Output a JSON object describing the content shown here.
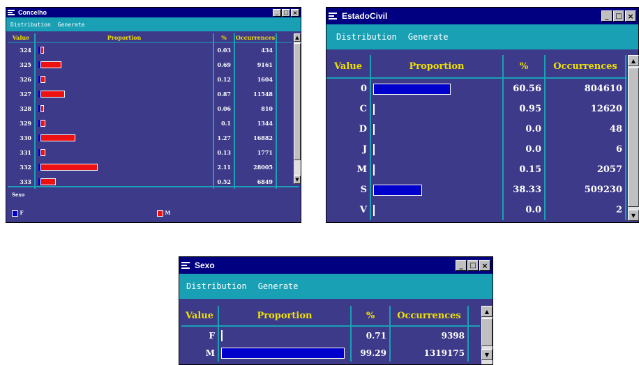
{
  "colors": {
    "female": "#0000cc",
    "male": "#ee1111",
    "bar": "#0000cc",
    "header_text": "#f0e000",
    "grid_bg": "#3d3a8a",
    "menubar": "#1aa0b4"
  },
  "concelho": {
    "title": "Concelho",
    "menu": [
      "Distribution",
      "Generate"
    ],
    "headers": [
      "Value",
      "Proportion",
      "%",
      "Occurrences"
    ],
    "rows": [
      {
        "value": "324",
        "pct": "0.03",
        "occ": "434",
        "f": 0.012,
        "m": 0.02
      },
      {
        "value": "325",
        "pct": "0.69",
        "occ": "9161",
        "f": 0.012,
        "m": 0.12
      },
      {
        "value": "326",
        "pct": "0.12",
        "occ": "1604",
        "f": 0.012,
        "m": 0.03
      },
      {
        "value": "327",
        "pct": "0.87",
        "occ": "11548",
        "f": 0.012,
        "m": 0.14
      },
      {
        "value": "328",
        "pct": "0.06",
        "occ": "810",
        "f": 0.012,
        "m": 0.02
      },
      {
        "value": "329",
        "pct": "0.1",
        "occ": "1344",
        "f": 0.012,
        "m": 0.03
      },
      {
        "value": "330",
        "pct": "1.27",
        "occ": "16882",
        "f": 0.012,
        "m": 0.2
      },
      {
        "value": "331",
        "pct": "0.13",
        "occ": "1771",
        "f": 0.012,
        "m": 0.03
      },
      {
        "value": "332",
        "pct": "2.11",
        "occ": "28005",
        "f": 0.012,
        "m": 0.33
      },
      {
        "value": "333",
        "pct": "0.52",
        "occ": "6849",
        "f": 0.012,
        "m": 0.09
      }
    ],
    "legend_title": "Sexo",
    "legend": [
      {
        "label": "F",
        "color": "#0000cc"
      },
      {
        "label": "M",
        "color": "#ee1111"
      }
    ]
  },
  "estadocivil": {
    "title": "EstadoCivil",
    "menu": [
      "Distribution",
      "Generate"
    ],
    "headers": [
      "Value",
      "Proportion",
      "%",
      "Occurrences"
    ],
    "rows": [
      {
        "value": "0",
        "pct": "60.56",
        "occ": "804610",
        "frac": 0.6056
      },
      {
        "value": "C",
        "pct": "0.95",
        "occ": "12620",
        "frac": 0.0095
      },
      {
        "value": "D",
        "pct": "0.0",
        "occ": "48",
        "frac": 0.0
      },
      {
        "value": "J",
        "pct": "0.0",
        "occ": "6",
        "frac": 0.0
      },
      {
        "value": "M",
        "pct": "0.15",
        "occ": "2057",
        "frac": 0.0015
      },
      {
        "value": "S",
        "pct": "38.33",
        "occ": "509230",
        "frac": 0.3833
      },
      {
        "value": "V",
        "pct": "0.0",
        "occ": "2",
        "frac": 0.0
      }
    ]
  },
  "sexo": {
    "title": "Sexo",
    "menu": [
      "Distribution",
      "Generate"
    ],
    "headers": [
      "Value",
      "Proportion",
      "%",
      "Occurrences"
    ],
    "rows": [
      {
        "value": "F",
        "pct": "0.71",
        "occ": "9398",
        "frac": 0.0071
      },
      {
        "value": "M",
        "pct": "99.29",
        "occ": "1319175",
        "frac": 0.9929
      }
    ]
  }
}
